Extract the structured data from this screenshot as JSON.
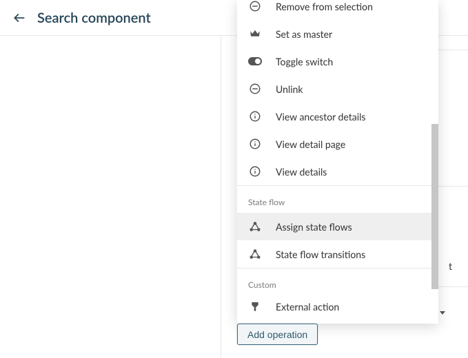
{
  "header": {
    "title": "Search component"
  },
  "menu": {
    "items": [
      {
        "label": "Remove from selection"
      },
      {
        "label": "Set as master"
      },
      {
        "label": "Toggle switch"
      },
      {
        "label": "Unlink"
      },
      {
        "label": "View ancestor details"
      },
      {
        "label": "View detail page"
      },
      {
        "label": "View details"
      }
    ],
    "section_stateflow": "State flow",
    "stateflow_items": [
      {
        "label": "Assign state flows"
      },
      {
        "label": "State flow transitions"
      }
    ],
    "section_custom": "Custom",
    "custom_items": [
      {
        "label": "External action"
      }
    ]
  },
  "add_button": "Add operation",
  "stray_char": "t"
}
